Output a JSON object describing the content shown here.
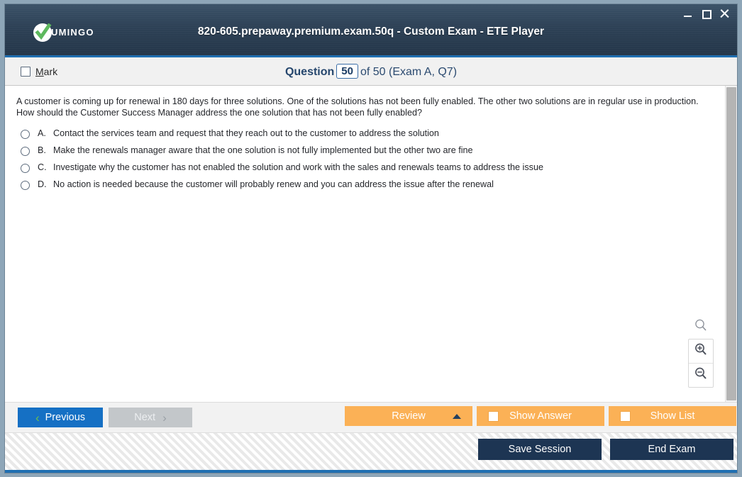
{
  "window": {
    "title": "820-605.prepaway.premium.exam.50q - Custom Exam - ETE Player",
    "logo_text": "UMINGO",
    "controls": {
      "minimize": "minimize-icon",
      "maximize": "maximize-icon",
      "close": "close-icon"
    }
  },
  "question_header": {
    "mark_label_prefix": "M",
    "mark_label_rest": "ark",
    "question_label": "Question",
    "question_number": "50",
    "of_text": "of 50 (Exam A, Q7)"
  },
  "question": {
    "text": "A customer is coming up for renewal in 180 days for three solutions. One of the solutions has not been fully enabled. The other two solutions are in regular use in production. How should the Customer Success Manager address the one solution that has not been fully enabled?",
    "options": [
      {
        "letter": "A.",
        "text": "Contact the services team and request that they reach out to the customer to address the solution"
      },
      {
        "letter": "B.",
        "text": "Make the renewals manager aware that the one solution is not fully implemented but the other two are fine"
      },
      {
        "letter": "C.",
        "text": "Investigate why the customer has not enabled the solution and work with the sales and renewals teams to address the issue"
      },
      {
        "letter": "D.",
        "text": "No action is needed because the customer will probably renew and you can address the issue after the renewal"
      }
    ]
  },
  "zoom_controls": {
    "reset": "magnifier-icon",
    "zoom_in": "zoom-in-icon",
    "zoom_out": "zoom-out-icon"
  },
  "toolbar": {
    "previous_label": "Previous",
    "previous_chevron": "‹",
    "next_label": "Next",
    "next_chevron": "›",
    "review_label": "Review",
    "show_answer_label": "Show Answer",
    "show_list_label": "Show List"
  },
  "statusbar": {
    "save_session_label": "Save Session",
    "end_exam_label": "End Exam"
  },
  "colors": {
    "titlebar": "#2e4257",
    "accent_blue": "#1f6fb2",
    "primary_button": "#1570c4",
    "orange_button": "#fbb156",
    "navy_button": "#1d3553",
    "green_check": "#5cb85c"
  }
}
